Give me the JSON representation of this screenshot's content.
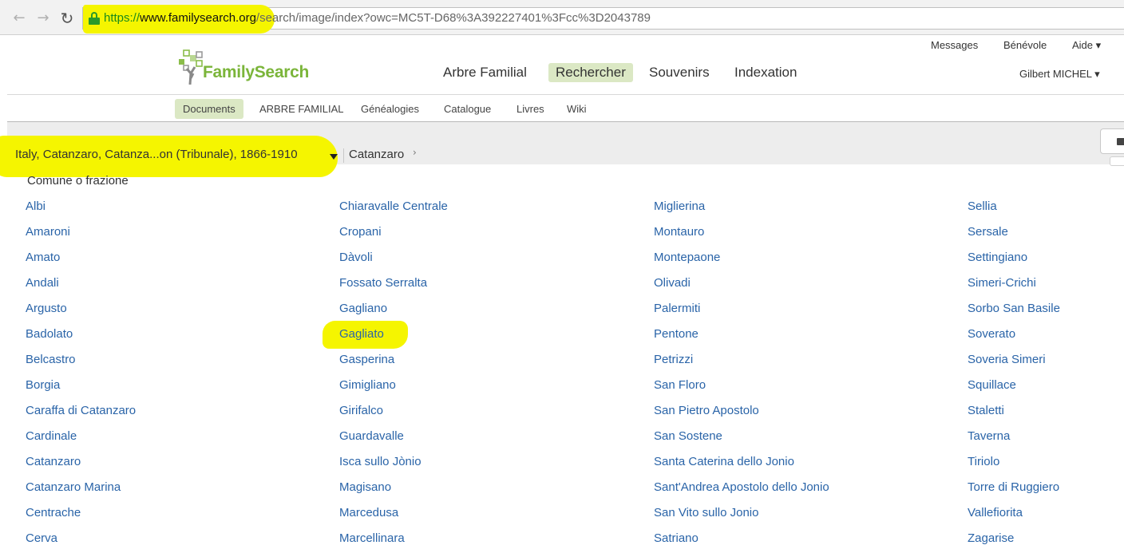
{
  "browser": {
    "url_secure": "https://",
    "url_domain": "www.familysearch.org",
    "url_path": "/search/image/index?owc=MC5T-D68%3A392227401%3Fcc%3D2043789"
  },
  "header": {
    "logo_text": "FamilySearch",
    "util_links": [
      "Messages",
      "Bénévole",
      "Aide ▾"
    ],
    "main_nav": [
      "Arbre Familial",
      "Rechercher",
      "Souvenirs",
      "Indexation"
    ],
    "user": "Gilbert MICHEL ▾"
  },
  "subnav": [
    "Documents",
    "ARBRE FAMILIAL",
    "Généalogies",
    "Catalogue",
    "Livres",
    "Wiki"
  ],
  "breadcrumb": {
    "collection": "Italy, Catanzaro, Catanza...on (Tribunale), 1866-1910",
    "current": "Catanzaro",
    "chevron": "›"
  },
  "content": {
    "heading": "Comune o frazione",
    "columns": [
      [
        "Albi",
        "Amaroni",
        "Amato",
        "Andali",
        "Argusto",
        "Badolato",
        "Belcastro",
        "Borgia",
        "Caraffa di Catanzaro",
        "Cardinale",
        "Catanzaro",
        "Catanzaro Marina",
        "Centrache",
        "Cerva"
      ],
      [
        "Chiaravalle Centrale",
        "Cropani",
        "Dàvoli",
        "Fossato Serralta",
        "Gagliano",
        "Gagliato",
        "Gasperina",
        "Gimigliano",
        "Girifalco",
        "Guardavalle",
        "Isca sullo Jònio",
        "Magisano",
        "Marcedusa",
        "Marcellinara"
      ],
      [
        "Miglierina",
        "Montauro",
        "Montepaone",
        "Olivadi",
        "Palermiti",
        "Pentone",
        "Petrizzi",
        "San Floro",
        "San Pietro Apostolo",
        "San Sostene",
        "Santa Caterina dello Jonio",
        "Sant'Andrea Apostolo dello Jonio",
        "San Vito sullo Jonio",
        "Satriano"
      ],
      [
        "Sellia",
        "Sersale",
        "Settingiano",
        "Simeri-Crichi",
        "Sorbo San Basile",
        "Soverato",
        "Soveria Simeri",
        "Squillace",
        "Staletti",
        "Taverna",
        "Tiriolo",
        "Torre di Ruggiero",
        "Vallefiorita",
        "Zagarise"
      ]
    ]
  },
  "colors": {
    "highlight": "#f5f500",
    "link": "#2a64a8",
    "brand_green": "#7bb53a",
    "active_tab": "#dbe8c4"
  }
}
